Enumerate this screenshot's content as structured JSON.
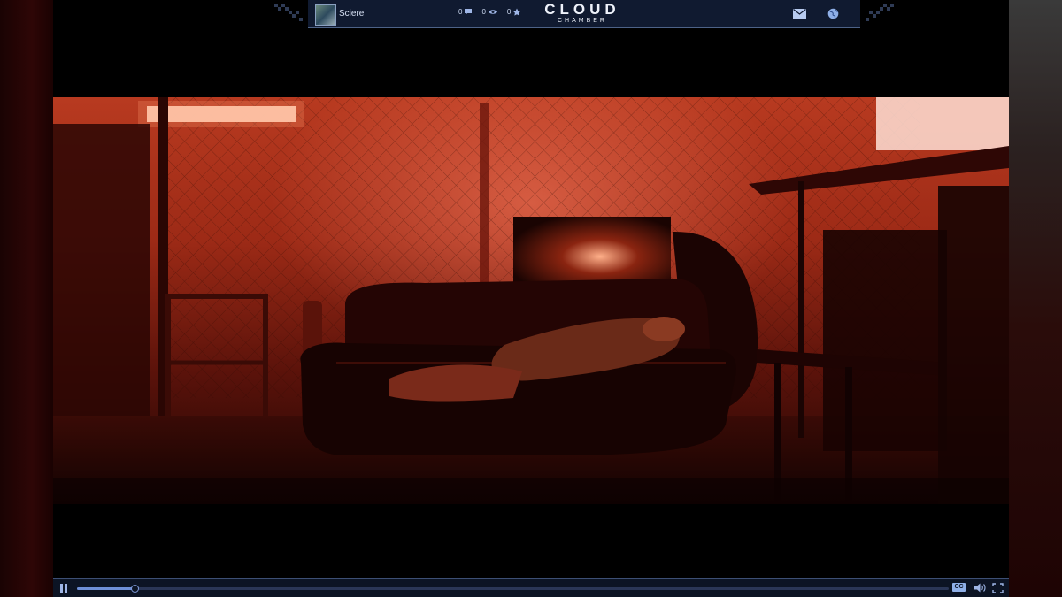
{
  "header": {
    "username": "Sciere",
    "stats": [
      {
        "icon": "chat-bubble-icon",
        "value": "0"
      },
      {
        "icon": "eye-icon",
        "value": "0"
      },
      {
        "icon": "star-icon",
        "value": "0"
      }
    ],
    "brand": {
      "line1": "CLOUD",
      "line2": "CHAMBER"
    },
    "actions": {
      "mail_icon": "mail-icon",
      "globe_icon": "globe-icon"
    }
  },
  "player": {
    "state": "playing",
    "progress": 0.066,
    "cc_label": "CC",
    "controls": [
      "pause-icon",
      "closed-captions-icon",
      "volume-icon",
      "fullscreen-icon"
    ]
  },
  "colors": {
    "hud_bg": "#101a30",
    "hud_border": "#4d6287",
    "accent": "#6e8fd6",
    "scene_red": "#b83a20"
  }
}
